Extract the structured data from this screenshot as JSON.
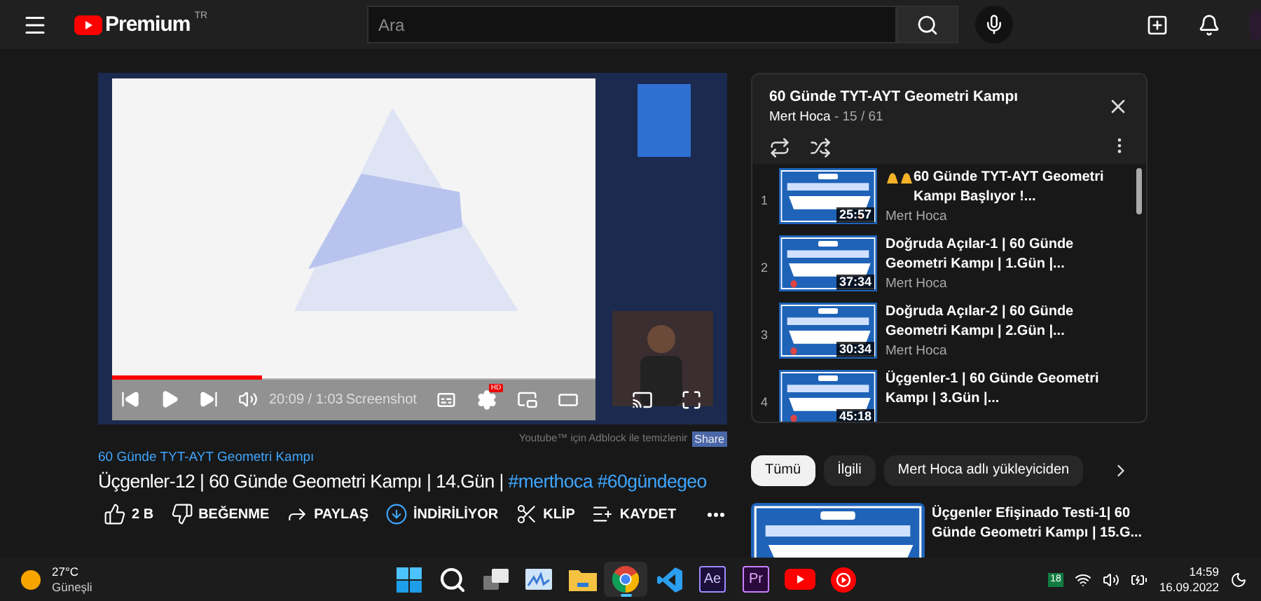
{
  "topbar": {
    "logo": "Premium",
    "region": "TR",
    "search": {
      "placeholder": "Ara"
    }
  },
  "player": {
    "progress": {
      "level": 0.31
    },
    "time": "20:09 / 1:03",
    "extension_label": "Screenshot",
    "hd_badge": "HD"
  },
  "adblock": {
    "text": "Youtube™ için Adblock ile temizlenir",
    "button": "Share"
  },
  "video": {
    "playlist_link": "60 Günde TYT-AYT Geometri Kampı",
    "title": "Üçgenler-12 | 60 Günde Geometri Kampı | 14.Gün |",
    "hashtags": [
      "#merthoca",
      "#60gündegeo"
    ]
  },
  "actions": [
    {
      "kind": "like",
      "label": "2 B"
    },
    {
      "kind": "dislike",
      "label": "BEĞENME"
    },
    {
      "kind": "share",
      "label": "PAYLAŞ"
    },
    {
      "kind": "download",
      "label": "İNDİRİLİYOR"
    },
    {
      "kind": "clip",
      "label": "KLİP"
    },
    {
      "kind": "save",
      "label": "KAYDET"
    },
    {
      "kind": "more"
    }
  ],
  "playlist": {
    "title": "60 Günde TYT-AYT Geometri Kampı",
    "owner": "Mert Hoca",
    "position": "- 15 / 61",
    "items": [
      {
        "index": "1",
        "kind": "announcement",
        "title": "60 Günde TYT-AYT Geometri Kampı Başlıyor !...",
        "channel": "Mert Hoca",
        "duration": "25:57"
      },
      {
        "index": "2",
        "kind": "video",
        "title": "Doğruda Açılar-1 | 60 Günde Geometri Kampı | 1.Gün |...",
        "channel": "Mert Hoca",
        "duration": "37:34"
      },
      {
        "index": "3",
        "kind": "video",
        "title": "Doğruda Açılar-2 | 60 Günde Geometri Kampı | 2.Gün |...",
        "channel": "Mert Hoca",
        "duration": "30:34"
      },
      {
        "index": "4",
        "kind": "video",
        "title": "Üçgenler-1 | 60 Günde Geometri Kampı | 3.Gün |...",
        "duration": "45:18"
      }
    ]
  },
  "chips": [
    {
      "label": "Tümü",
      "selected": true
    },
    {
      "label": "İlgili",
      "selected": false
    },
    {
      "label": "Mert Hoca adlı yükleyiciden",
      "selected": false
    }
  ],
  "recommended": [
    {
      "title": "Üçgenler Efişinado Testi-1| 60 Günde Geometri Kampı | 15.G..."
    }
  ],
  "taskbar": {
    "weather": {
      "temperature": "27°C",
      "condition": "Güneşli"
    },
    "apps": [
      {
        "kind": "start",
        "active": false
      },
      {
        "kind": "search",
        "active": false
      },
      {
        "kind": "taskview",
        "active": false
      },
      {
        "kind": "monitor",
        "active": false
      },
      {
        "kind": "folder",
        "active": false
      },
      {
        "kind": "chrome",
        "active": true
      },
      {
        "kind": "vscode",
        "active": false
      },
      {
        "kind": "after-effects",
        "label": "Ae",
        "active": false
      },
      {
        "kind": "premiere",
        "label": "Pr",
        "active": false
      },
      {
        "kind": "youtube",
        "active": false
      },
      {
        "kind": "ytmusic",
        "active": false
      }
    ],
    "tray_badge": "18",
    "time": "14:59",
    "date": "16.09.2022"
  }
}
